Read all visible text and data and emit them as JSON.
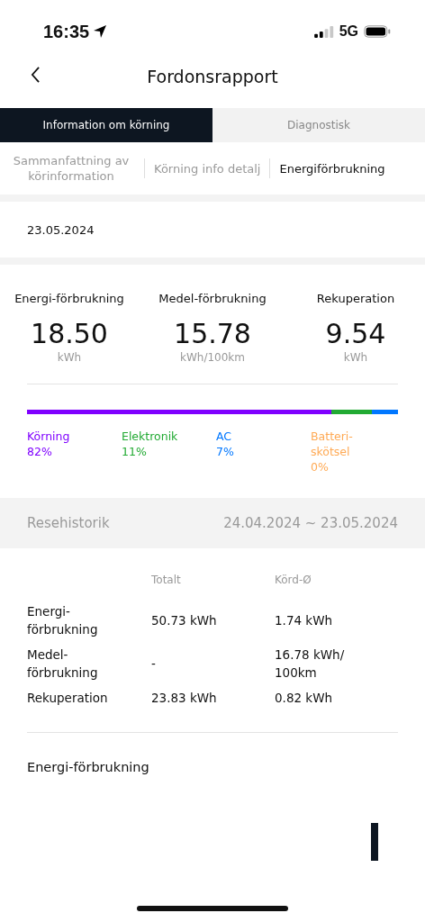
{
  "status_bar": {
    "time": "16:35",
    "network": "5G"
  },
  "nav": {
    "title": "Fordonsrapport"
  },
  "tabs": [
    {
      "label": "Information om körning",
      "selected": true
    },
    {
      "label": "Diagnostisk",
      "selected": false
    }
  ],
  "subtabs": [
    {
      "label": "Sammanfattning av körinformation",
      "selected": false
    },
    {
      "label": "Körning info detalj",
      "selected": false
    },
    {
      "label": "Energiförbrukning",
      "selected": true
    }
  ],
  "date": "23.05.2024",
  "stats": [
    {
      "label": "Energi-förbrukning",
      "value": "18.50",
      "unit": "kWh"
    },
    {
      "label": "Medel-förbrukning",
      "value": "15.78",
      "unit": "kWh/100km"
    },
    {
      "label": "Rekuperation",
      "value": "9.54",
      "unit": "kWh"
    }
  ],
  "breakdown": [
    {
      "name": "Körning",
      "percent": "82%",
      "color": "#7f00ff"
    },
    {
      "name": "Elektronik",
      "percent": "11%",
      "color": "#22aa33"
    },
    {
      "name": "AC",
      "percent": "7%",
      "color": "#0077ff"
    },
    {
      "name": "Batteri-skötsel",
      "percent": "0%",
      "color": "#ffaa55"
    }
  ],
  "history": {
    "title": "Resehistorik",
    "range": "24.04.2024 ~ 23.05.2024",
    "columns": [
      "Totalt",
      "Körd-Ø"
    ],
    "rows": [
      {
        "label": "Energi-förbrukning",
        "total": "50.73 kWh",
        "avg": "1.74 kWh"
      },
      {
        "label": "Medel-förbrukning",
        "total": "-",
        "avg": "16.78 kWh/ 100km"
      },
      {
        "label": "Rekuperation",
        "total": "23.83 kWh",
        "avg": "0.82 kWh"
      }
    ]
  },
  "chart_title": "Energi-förbrukning"
}
